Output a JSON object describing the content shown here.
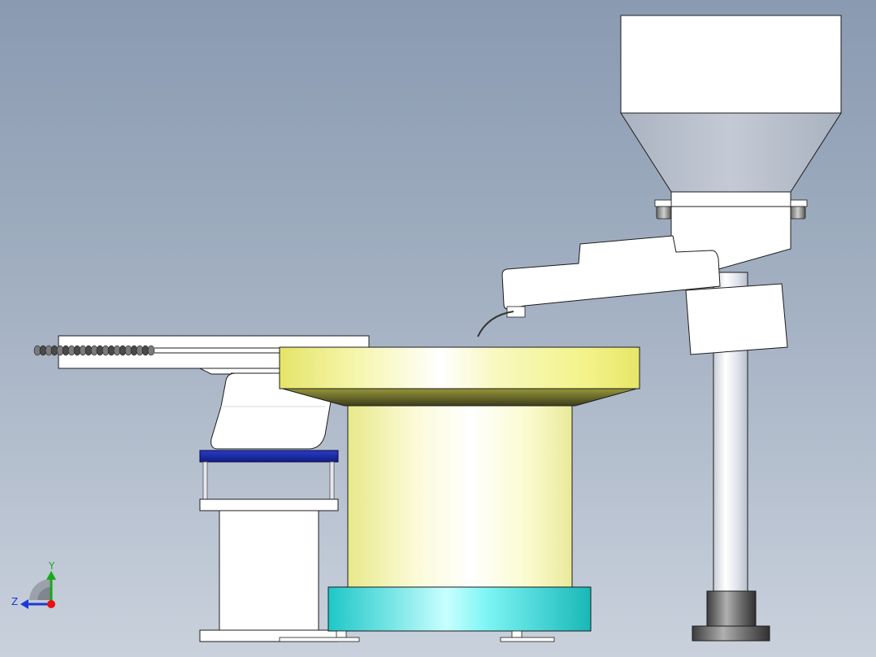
{
  "viewport": {
    "background_top": "#8a9ab1",
    "background_bottom": "#c9d1dc"
  },
  "triad": {
    "y_label": "Y",
    "z_label": "Z",
    "x_color": "#e81010",
    "y_color": "#1aa81a",
    "z_color": "#1a3ad8"
  },
  "colors": {
    "bowl_yellow": "#f2f29a",
    "bowl_base_cyan": "#33e0e0",
    "mount_plate_blue": "#1a2aa8",
    "hopper_gray": "#b7bfcc",
    "part_white": "#ffffff",
    "outline": "#1c1c1c"
  },
  "parts": [
    "linear-feeder-track",
    "vibratory-bowl",
    "bowl-base",
    "linear-feeder-drive",
    "mount-plate",
    "support-column",
    "hopper",
    "hopper-chute",
    "hopper-post",
    "post-foot"
  ]
}
